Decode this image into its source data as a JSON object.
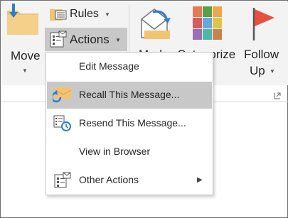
{
  "ribbon": {
    "move": {
      "label": "Move",
      "icon": "move-folder-icon"
    },
    "rules": {
      "label": "Rules",
      "icon": "rules-icon"
    },
    "actions": {
      "label": "Actions",
      "icon": "actions-icon",
      "state": "pressed"
    },
    "mark": {
      "label": "Mark",
      "icon": "mark-unread-envelope-icon"
    },
    "categorize": {
      "label": "Categorize",
      "icon": "categorize-grid-icon"
    },
    "follow_up": {
      "line1": "Follow",
      "line2": "Up",
      "icon": "flag-icon"
    }
  },
  "menu": {
    "items": [
      {
        "label": "Edit Message",
        "icon": "",
        "selected": false,
        "submenu": false
      },
      {
        "label": "Recall This Message...",
        "icon": "recall-message-icon",
        "selected": true,
        "submenu": false
      },
      {
        "label": "Resend This Message...",
        "icon": "resend-message-icon",
        "selected": false,
        "submenu": false
      },
      {
        "label": "View in Browser",
        "icon": "",
        "selected": false,
        "submenu": false
      },
      {
        "label": "Other Actions",
        "icon": "other-actions-icon",
        "selected": false,
        "submenu": true
      }
    ]
  },
  "colors": {
    "ribbon_bg": "#f3f3f3",
    "pressed_bg": "#c8c8c8",
    "folder": "#f1c373",
    "arrow_blue": "#2a7fcf",
    "flag_red": "#e5523f"
  }
}
